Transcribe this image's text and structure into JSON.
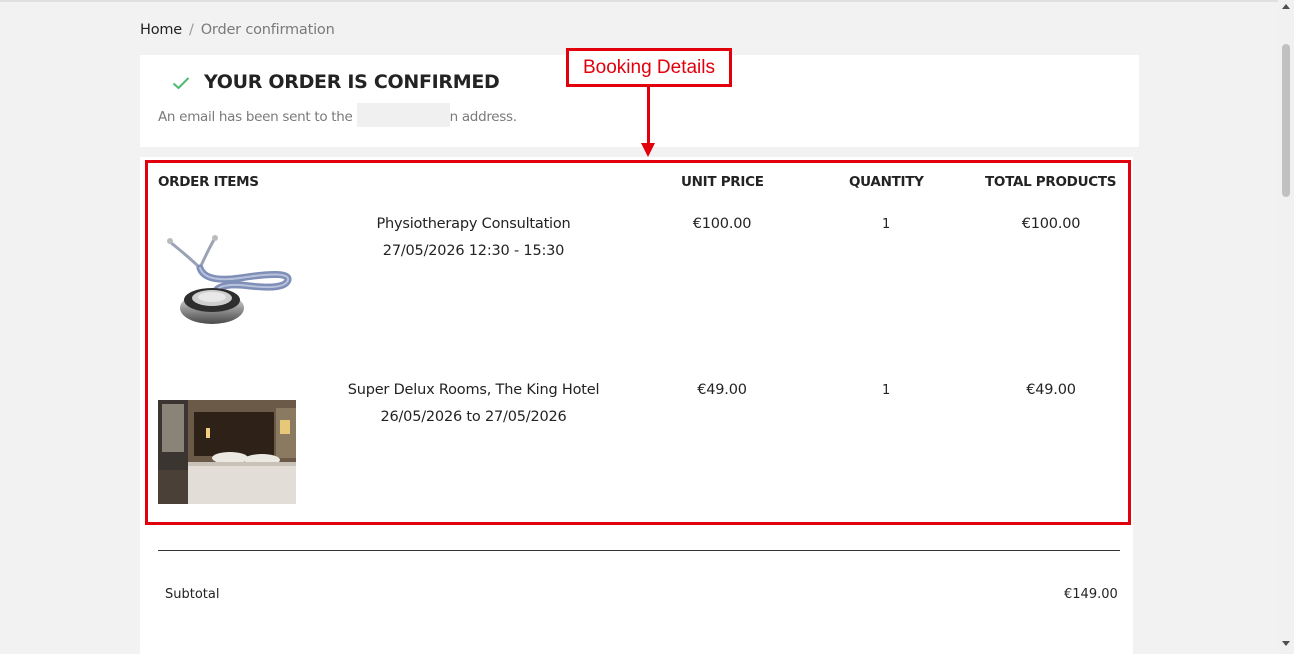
{
  "breadcrumb": {
    "home": "Home",
    "separator": "/",
    "current": "Order confirmation"
  },
  "confirmation": {
    "icon": "check-icon",
    "title": "YOUR ORDER IS CONFIRMED",
    "email_prefix": "An email has been sent to the",
    "email_suffix": "n address."
  },
  "order_table": {
    "headers": {
      "items": "ORDER ITEMS",
      "unit_price": "UNIT PRICE",
      "quantity": "QUANTITY",
      "total": "TOTAL PRODUCTS"
    },
    "rows": [
      {
        "image": "stethoscope-image",
        "name": "Physiotherapy Consultation",
        "detail": "27/05/2026 12:30 - 15:30",
        "unit_price": "€100.00",
        "quantity": "1",
        "total": "€100.00"
      },
      {
        "image": "hotel-room-image",
        "name": "Super Delux Rooms, The King Hotel",
        "detail": "26/05/2026 to 27/05/2026",
        "unit_price": "€49.00",
        "quantity": "1",
        "total": "€49.00"
      }
    ]
  },
  "totals": {
    "subtotal_label": "Subtotal",
    "subtotal_value": "€149.00"
  },
  "annotation": {
    "label": "Booking Details",
    "color": "#e2000c"
  },
  "colors": {
    "check": "#4cbb6c",
    "background": "#f2f2f2",
    "card": "#ffffff",
    "text": "#232323",
    "muted": "#7a7a7a"
  }
}
